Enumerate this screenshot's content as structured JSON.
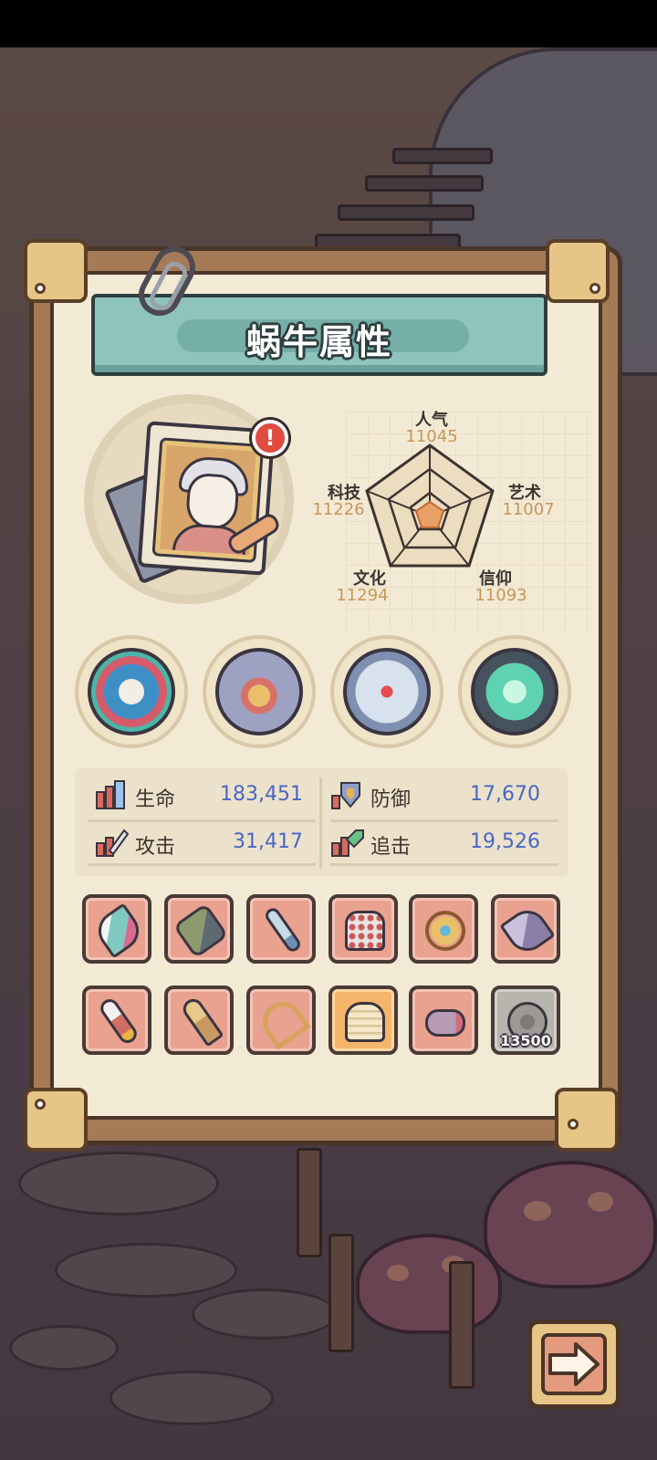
{
  "page": {
    "title": "蜗牛属性"
  },
  "avatar": {
    "alert_badge": "!"
  },
  "radar": [
    {
      "label": "人气",
      "value": "11045"
    },
    {
      "label": "艺术",
      "value": "11007"
    },
    {
      "label": "信仰",
      "value": "11093"
    },
    {
      "label": "文化",
      "value": "11294"
    },
    {
      "label": "科技",
      "value": "11226"
    }
  ],
  "orbs": [
    {
      "icon": "sea-monster-relic-icon"
    },
    {
      "icon": "mech-arm-relic-icon"
    },
    {
      "icon": "compass-relic-icon"
    },
    {
      "icon": "jade-portal-relic-icon"
    }
  ],
  "stats": [
    {
      "label": "生命",
      "value": "183,451",
      "icon": "health-stat-icon"
    },
    {
      "label": "防御",
      "value": "17,670",
      "icon": "defense-stat-icon"
    },
    {
      "label": "攻击",
      "value": "31,417",
      "icon": "attack-stat-icon"
    },
    {
      "label": "追击",
      "value": "19,526",
      "icon": "pursuit-stat-icon"
    }
  ],
  "equipment": {
    "row1": [
      {
        "icon": "feather-icon",
        "tint": "#7fc9c2"
      },
      {
        "icon": "hammer-icon",
        "tint": "#8c9a6e"
      },
      {
        "icon": "sword-icon",
        "tint": "#9fb7c8"
      },
      {
        "icon": "robe-icon",
        "tint": "#e4d9d6"
      },
      {
        "icon": "ring-icon",
        "tint": "#d59a5a"
      },
      {
        "icon": "crystal-icon",
        "tint": "#a39ab8"
      }
    ],
    "row2": [
      {
        "icon": "drill-staff-icon",
        "tint": "#cf6f63"
      },
      {
        "icon": "skull-mace-icon",
        "tint": "#c89a62"
      },
      {
        "icon": "bow-icon",
        "tint": "#d7a35c"
      },
      {
        "icon": "mummy-trophy-icon",
        "tint": "#eed8aa"
      },
      {
        "icon": "scroll-icon",
        "tint": "#b79bb4"
      },
      {
        "icon": "rose-icon",
        "tint": "#9d9994",
        "locked": true,
        "count": "13500"
      }
    ]
  },
  "colors": {
    "accent": "#8fc3bd",
    "stat_value": "#4a66c4",
    "radar_value": "#c8965a",
    "slot": "#e9a190"
  }
}
